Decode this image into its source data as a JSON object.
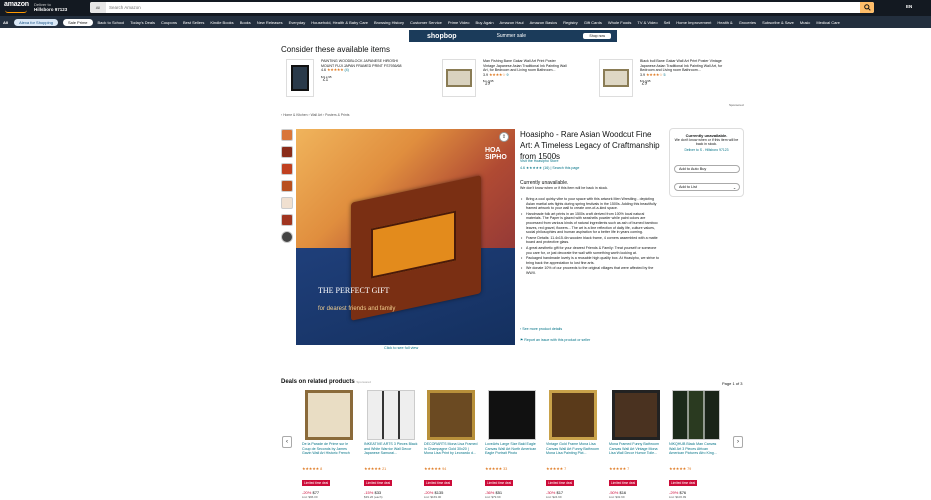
{
  "nav": {
    "logo": "amazon",
    "deliver_line1": "Deliver to",
    "deliver_line2": "Hillsboro 97123",
    "search_category": "All",
    "search_placeholder": "Search Amazon",
    "flag": "EN"
  },
  "subnav": {
    "all": "All",
    "pills": [
      "Alexa for Shopping",
      "Sale Prime"
    ],
    "items": [
      "Back to School",
      "Today's Deals",
      "Coupons",
      "Best Sellers",
      "Kindle Books",
      "Books",
      "New Releases",
      "Everyday",
      "Household, Health & Baby Care",
      "Browsing History",
      "Customer Service",
      "Prime Video",
      "Buy Again",
      "Amazon Haul",
      "Amazon Basics",
      "Registry",
      "Gift Cards",
      "Whole Foods",
      "TV & Video",
      "Sell",
      "Home Improvement",
      "Health &",
      "Groceries",
      "Subscribe & Save",
      "Music",
      "Medical Care"
    ]
  },
  "promo": {
    "title": "shopbop",
    "text": "Summer sale",
    "cta": "Shop now"
  },
  "consider": {
    "heading": "Consider these available items",
    "products": [
      {
        "title": "PAINTING WOODBLOCK JAPANESE HIROSHI MOUNT FUJI JAPAN FRAMED PRINT FS7936/68",
        "rating": "4.6",
        "count": "(4)",
        "price": "21",
        "cents": "95"
      },
      {
        "title": "Man Fishing Bane Gakar Wall Art Print Poster Vintage Japanese Asian Traditional Ink Painting Wall Art, for Bedroom and Living room Bathroom...",
        "rating": "3.9",
        "count": "9",
        "price": "19",
        "cents": "95"
      },
      {
        "title": "Black bull Bane Gakar Wall Art Print Poster Vintage Japanese Asian Traditional Ink Painting Wall Art, for Bedroom and Living room Bathroom...",
        "rating": "3.9",
        "count": "5",
        "price": "29",
        "cents": "95"
      }
    ],
    "sponsored": "Sponsored"
  },
  "breadcrumb": "‹ Home & Kitchen › Wall Art › Posters & Prints",
  "product": {
    "title": "Hoasipho - Rare Asian Woodcut Fine Art: A Timeless Legacy of Craftmanship from 1500s",
    "store": "Visit the Hoasipho Store",
    "rating": "4.6 ★★★★★ (16) | Search this page",
    "unavailable": "Currently unavailable.",
    "unavailable_note": "We don't know when or if this item will be back in stock.",
    "bullets": [
      "Bring a cool quirky vibe to your space with this artwork Men Wrestling - depicting Asian martial arts fights during spring festivals in the 1500s. Adding this beautifully framed artwork to your wall to create one-of-a-kind space.",
      "Handmade folk art prints in an 1500s craft derived from 100% local natural materials. The Paper is glazed with seashells powder while paint colors are processed from various kinds of natural ingredients such as ash of burned bamboo leaves, red gravel, flowers... The art is a line reflection of daily life, culture values, social philosophies and human aspiration for a better life in years coming.",
      "Frame Details: 11.4x15.4in wooden black frame, 4 corners assembled with a matte board and protective glass.",
      "A great aesthetic gift for your dearest Friends & Family: Treat yourself or someone you care for, or just decorate the wall with something worth looking at.",
      "Packaged handmade lovely is a reusable high quality box. At Hoasipho, we strive to bring back the appreciation to lost fine arts.",
      "We donate 10% of our proceeds to the original villages that were affected by the WWII."
    ],
    "see_more": "› See more product details",
    "report": "Report an issue with this product or seller",
    "click_to_see": "Click to see full view",
    "image_text": {
      "gift": "THE PERFECT GIFT",
      "sub": "for dearest friends and family",
      "brand": "HOA SIPHO"
    }
  },
  "buybox": {
    "unavailable": "Currently unavailable.",
    "note": "We don't know when or if this item will be back in stock.",
    "location": "Deliver to S - Hillsboro 97123",
    "auto_buy": "Add to Auto Buy",
    "add_list": "Add to List"
  },
  "deals": {
    "heading": "Deals on related products",
    "sponsored": "Sponsored",
    "page": "Page 1 of 3",
    "items": [
      {
        "title": "De la Parade de Prime sur le Coup de Seconds by James Gavin Wall Art Historic French",
        "stars": "★★★★★ 8",
        "badge": "Limited time deal",
        "pct": "-20%",
        "price": "$77",
        "list": "List: $96.00"
      },
      {
        "title": "INKEATIVE ARTS 3 Pieces Black and White Warrior Wall Decor Japanese Samurai...",
        "stars": "★★★★★ 21",
        "badge": "Limited time deal",
        "pct": "-15%",
        "price": "$33",
        "list": "$39.26 (each)"
      },
      {
        "title": "DECORARTS Mona Lisa Framed in Champagne Gold 30x20 | Mona Lisa Print by Leonardo d...",
        "stars": "★★★★★ 94",
        "badge": "Limited time deal",
        "pct": "-20%",
        "price": "$135",
        "list": "List: $169.00"
      },
      {
        "title": "LoveArts Large Size Bald Eagle Canvas Wall Art North American Eagle Portrait Photo",
        "stars": "★★★★★ 33",
        "badge": "Limited time deal",
        "pct": "-36%",
        "price": "$51",
        "list": "List: $79.99"
      },
      {
        "title": "Vintage Gold Frame Mona Lisa Canvas Wall Art Funny Bathroom Mona Lisa Painting Pict...",
        "stars": "★★★★★ 7",
        "badge": "Limited time deal",
        "pct": "-30%",
        "price": "$17",
        "list": "List: $24.99"
      },
      {
        "title": "Mona Framed Funny Bathroom Canvas Wall Art Vintage Mona Lisa Wall Decor Humor Toile...",
        "stars": "★★★★★ 7",
        "badge": "Limited time deal",
        "pct": "-50%",
        "price": "$16",
        "list": "List: $32.99"
      },
      {
        "title": "NIKQHUB Black Man Canvas Wall Art 3 Pieces African American Pictures Afro King...",
        "stars": "★★★★★ 79",
        "badge": "Limited time deal",
        "pct": "-29%",
        "price": "$76",
        "list": "List: $106.99"
      }
    ]
  }
}
